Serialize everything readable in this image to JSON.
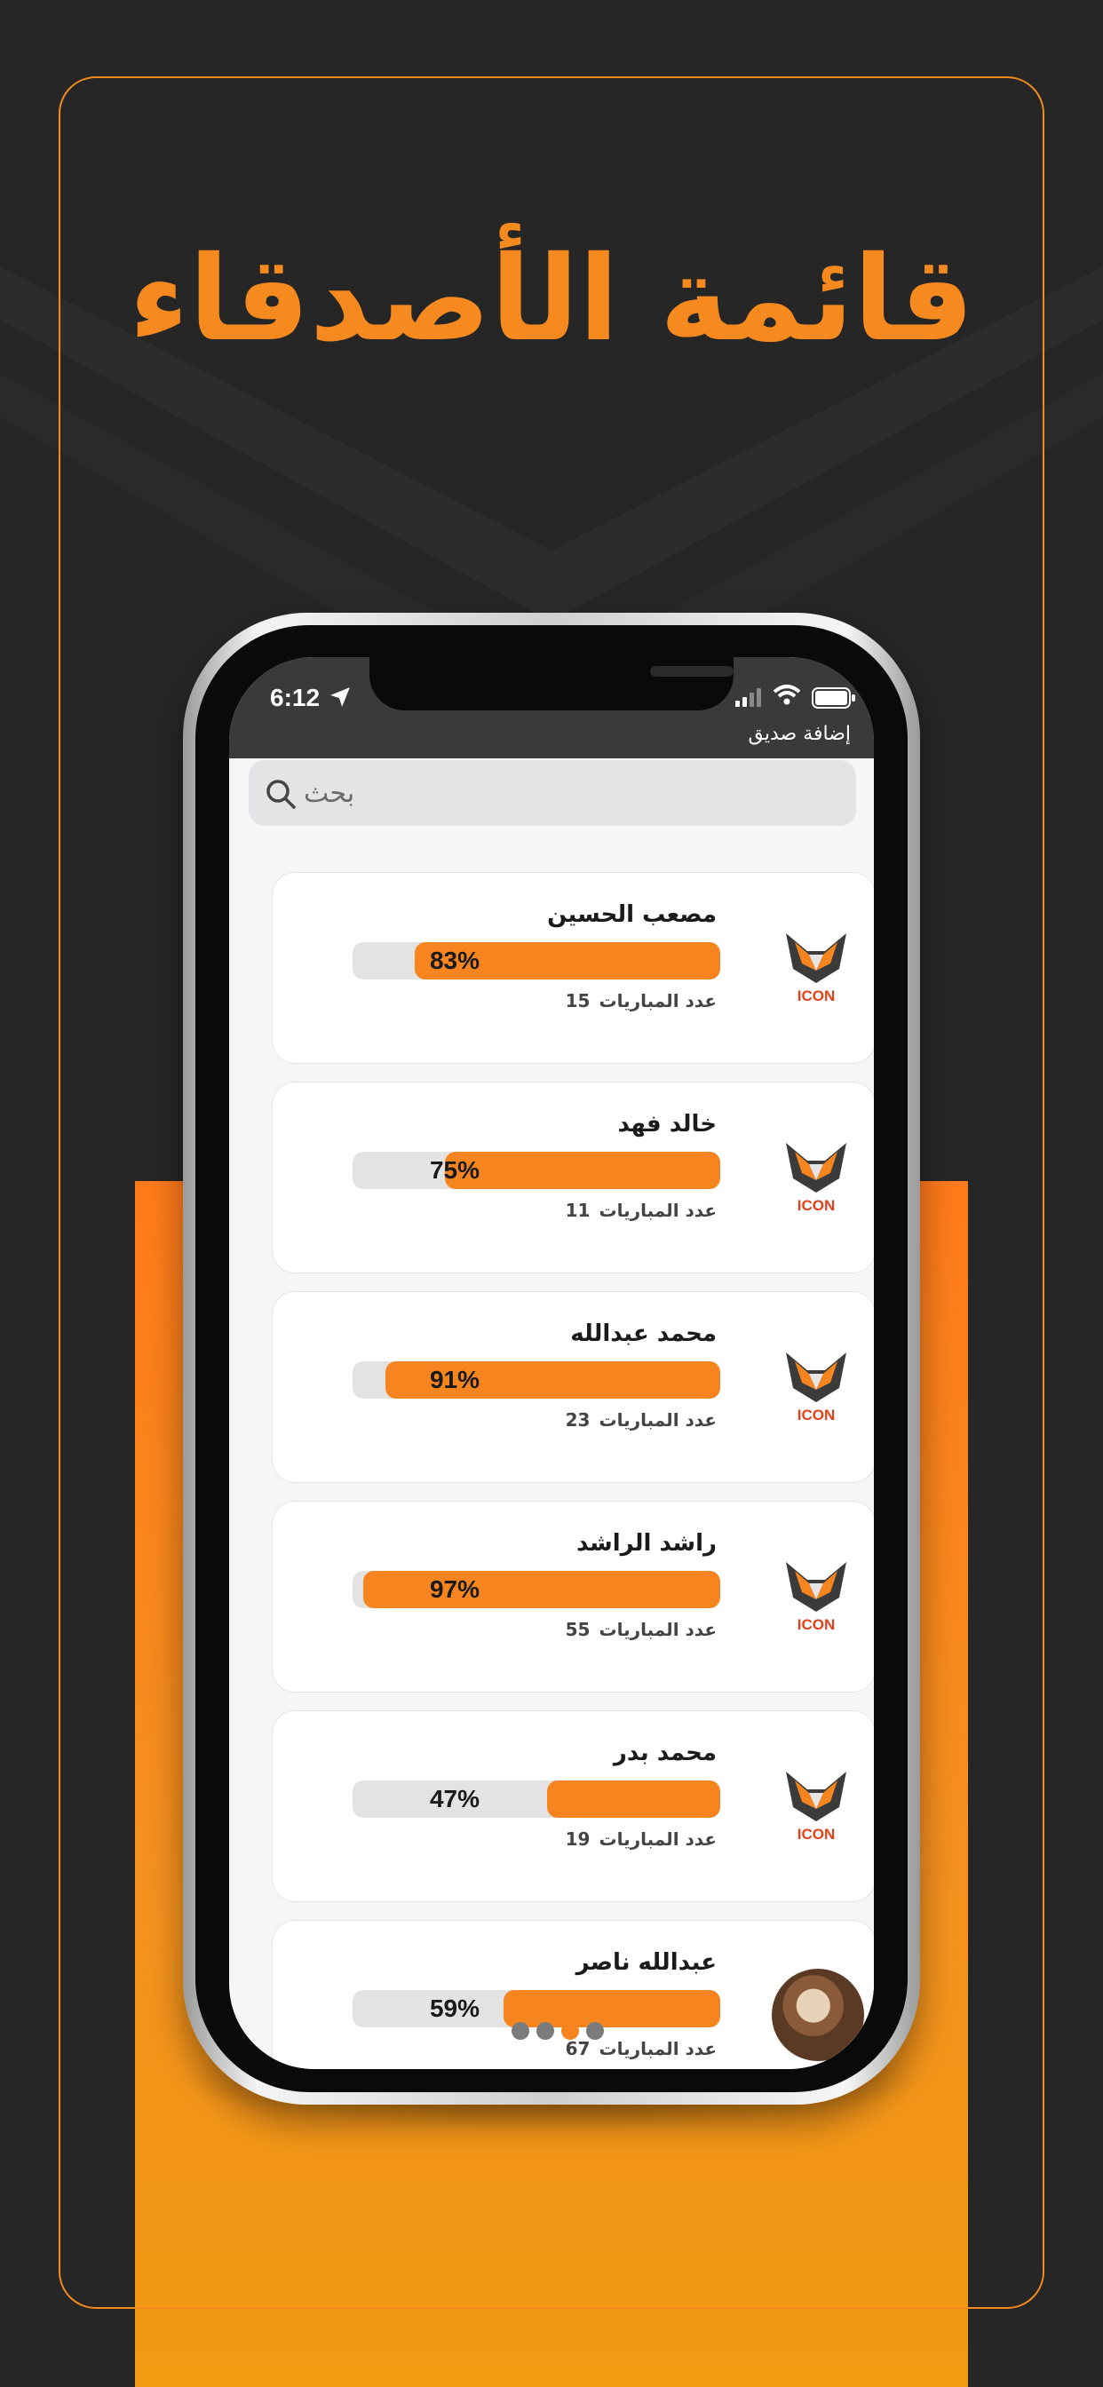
{
  "headline": "قائمة الأصدقاء",
  "status_bar": {
    "time": "6:12"
  },
  "header": {
    "add_friend_label": "إضافة صديق"
  },
  "search": {
    "placeholder": "بحث"
  },
  "matches_label": "عدد المباريات",
  "logo_text": "ICON",
  "friends": [
    {
      "name": "مصعب الحسين",
      "percent_label": "83%",
      "percent": 83,
      "matches": "15",
      "avatar": "icon-logo"
    },
    {
      "name": "خالد فهد",
      "percent_label": "75%",
      "percent": 75,
      "matches": "11",
      "avatar": "icon-logo"
    },
    {
      "name": "محمد عبدالله",
      "percent_label": "91%",
      "percent": 91,
      "matches": "23",
      "avatar": "icon-logo"
    },
    {
      "name": "راشد الراشد",
      "percent_label": "97%",
      "percent": 97,
      "matches": "55",
      "avatar": "icon-logo"
    },
    {
      "name": "محمد بدر",
      "percent_label": "47%",
      "percent": 47,
      "matches": "19",
      "avatar": "icon-logo"
    },
    {
      "name": "عبدالله ناصر",
      "percent_label": "59%",
      "percent": 59,
      "matches": "67",
      "avatar": "photo"
    }
  ],
  "pager": {
    "count": 4,
    "active_index": 2
  },
  "colors": {
    "accent": "#f7851f",
    "background": "#262626",
    "track": "#e3e3e3"
  }
}
